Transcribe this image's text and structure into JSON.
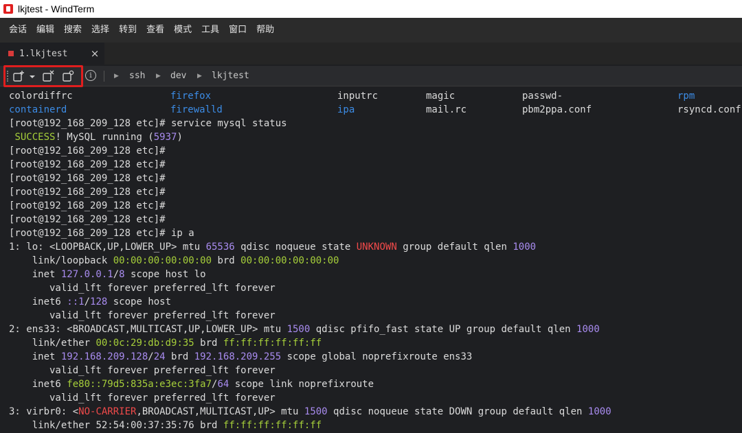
{
  "window": {
    "title": "lkjtest - WindTerm",
    "icon": "windterm-logo-icon"
  },
  "menu": [
    "会话",
    "编辑",
    "搜索",
    "选择",
    "转到",
    "查看",
    "模式",
    "工具",
    "窗口",
    "帮助"
  ],
  "tab": {
    "label": "1.lkjtest",
    "close": "×"
  },
  "toolbar": {
    "info": "i",
    "breadcrumb": [
      "ssh",
      "dev",
      "lkjtest"
    ]
  },
  "terminal": {
    "ls": [
      [
        "colordiffrc",
        "firefox",
        "inputrc",
        "magic",
        "passwd-",
        "rpm"
      ],
      [
        "containerd",
        "firewalld",
        "ipa",
        "mail.rc",
        "pbm2ppa.conf",
        "rsyncd.conf"
      ]
    ],
    "prompt": "[root@192_168_209_128 etc]#",
    "lines": {
      "cmd_mysql": " service mysql status",
      "success_word": "SUCCESS",
      "mysql_rest": "! MySQL running (",
      "mysql_pid": "5937",
      "mysql_close": ")",
      "cmd_ip": " ip a",
      "lo_a": "1: lo: <LOOPBACK,UP,LOWER_UP> mtu ",
      "lo_mtu": "65536",
      "lo_b": " qdisc noqueue state ",
      "lo_state": "UNKNOWN",
      "lo_c": " group default qlen ",
      "lo_qlen": "1000",
      "lo_link_a": "    link/loopback ",
      "lo_mac": "00:00:00:00:00:00",
      "lo_link_b": " brd ",
      "lo_brd": "00:00:00:00:00:00",
      "lo_inet_a": "    inet ",
      "lo_ip": "127.0.0.1",
      "lo_slash": "/",
      "lo_mask": "8",
      "lo_inet_b": " scope host lo",
      "valid": "       valid_lft forever preferred_lft forever",
      "lo_inet6_a": "    inet6 ",
      "lo_ip6": "::1",
      "lo_mask6": "128",
      "lo_inet6_b": " scope host",
      "ens_a": "2: ens33: <BROADCAST,MULTICAST,UP,LOWER_UP> mtu ",
      "ens_mtu": "1500",
      "ens_b": " qdisc pfifo_fast state UP group default qlen ",
      "ens_qlen": "1000",
      "ens_link_a": "    link/ether ",
      "ens_mac": "00:0c:29:db:d9:35",
      "ens_link_b": " brd ",
      "ens_brd": "ff:ff:ff:ff:ff:ff",
      "ens_inet_a": "    inet ",
      "ens_ip": "192.168.209.128",
      "ens_mask": "24",
      "ens_inet_b": " brd ",
      "ens_bcast": "192.168.209.255",
      "ens_inet_c": " scope global noprefixroute ens33",
      "ens_inet6_a": "    inet6 ",
      "ens_ip6": "fe80::79d5:835a:e3ec:3fa7",
      "ens_mask6": "64",
      "ens_inet6_b": " scope link noprefixroute",
      "vir_a": "3: virbr0: <",
      "vir_nocarrier": "NO-CARRIER",
      "vir_b": ",BROADCAST,MULTICAST,UP> mtu ",
      "vir_mtu": "1500",
      "vir_c": " qdisc noqueue state DOWN group default qlen ",
      "vir_qlen": "1000",
      "vir_link_a": "    link/ether ",
      "vir_mac": "52:54:00:37:35:76",
      "vir_link_b": " brd ",
      "vir_brd": "ff:ff:ff:ff:ff:ff"
    }
  },
  "colors": {
    "accent_red": "#e01e1e",
    "dir_blue": "#3c8ce6",
    "num_purple": "#a98cf0",
    "mac_green": "#a6cf3a"
  }
}
